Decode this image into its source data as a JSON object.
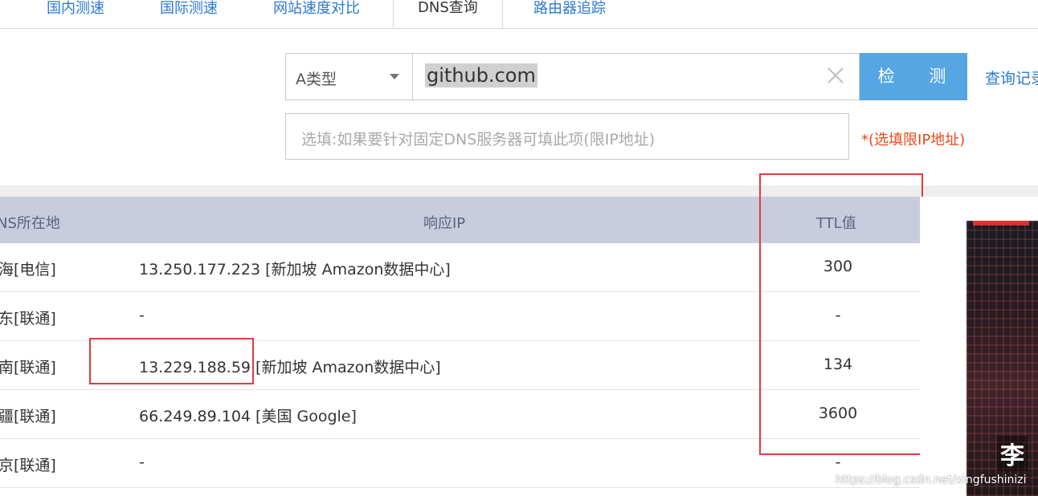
{
  "tabs": [
    {
      "label": "国内测速",
      "active": false
    },
    {
      "label": "国际测速",
      "active": false
    },
    {
      "label": "网站速度对比",
      "active": false
    },
    {
      "label": "DNS查询",
      "active": true
    },
    {
      "label": "路由器追踪",
      "active": false
    }
  ],
  "query": {
    "record_type": "A类型",
    "domain": "github.com",
    "detect_label": "检 测",
    "history_label": "查询记录",
    "dns_placeholder": "选填:如果要针对固定DNS服务器可填此项(限IP地址)",
    "dns_note": "*(选填限IP地址)"
  },
  "table": {
    "headers": {
      "location": "NS所在地",
      "ip": "响应IP",
      "ttl": "TTL值"
    },
    "rows": [
      {
        "location": "海[电信]",
        "ip": "13.250.177.223 [新加坡 Amazon数据中心]",
        "ttl": "300"
      },
      {
        "location": "东[联通]",
        "ip": "-",
        "ttl": "-"
      },
      {
        "location": "南[联通]",
        "ip": "13.229.188.59 [新加坡 Amazon数据中心]",
        "ttl": "134"
      },
      {
        "location": "疆[联通]",
        "ip": "66.249.89.104 [美国 Google]",
        "ttl": "3600"
      },
      {
        "location": "京[联通]",
        "ip": "-",
        "ttl": "-"
      }
    ]
  },
  "ad": {
    "text": "李"
  },
  "watermark": "https://blog.csdn.net/xingfushinizi"
}
